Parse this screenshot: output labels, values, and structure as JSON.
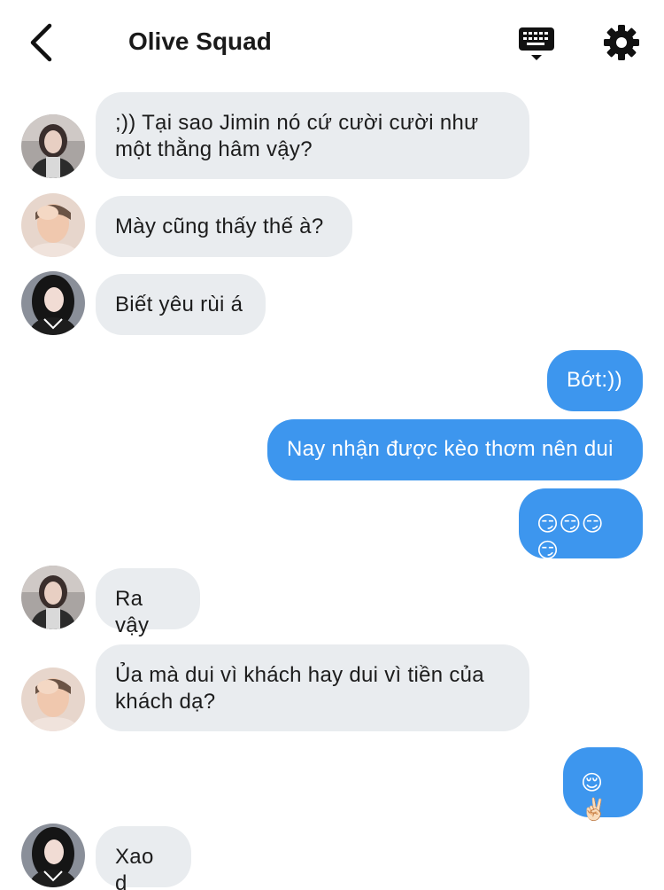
{
  "header": {
    "title": "Olive Squad",
    "back_icon": "chevron-left-icon",
    "keyboard_icon": "keyboard-icon",
    "settings_icon": "gear-icon"
  },
  "colors": {
    "incoming_bubble": "#e9ecef",
    "outgoing_bubble": "#3d96ee",
    "text_dark": "#1c1c1c"
  },
  "messages": [
    {
      "direction": "in",
      "avatar": "member-a",
      "text": ";)) Tại sao Jimin nó cứ cười cười như một thằng hâm vậy?"
    },
    {
      "direction": "in",
      "avatar": "member-b",
      "text": "Mày cũng thấy thế à?"
    },
    {
      "direction": "in",
      "avatar": "member-c",
      "text": "Biết yêu rùi á"
    },
    {
      "direction": "out",
      "text": "Bớt:))"
    },
    {
      "direction": "out",
      "text": "Nay nhận được kèo thơm nên dui"
    },
    {
      "direction": "out",
      "text": "😏😏😏😏"
    },
    {
      "direction": "in",
      "avatar": "member-a",
      "text": "Ra vậy"
    },
    {
      "direction": "in",
      "avatar": "member-b",
      "text": "Ủa mà dui vì khách hay dui vì tiền của khách dạ?"
    },
    {
      "direction": "out",
      "text": "😌✌🏻"
    },
    {
      "direction": "in",
      "avatar": "member-c",
      "text": "Xao d"
    }
  ]
}
